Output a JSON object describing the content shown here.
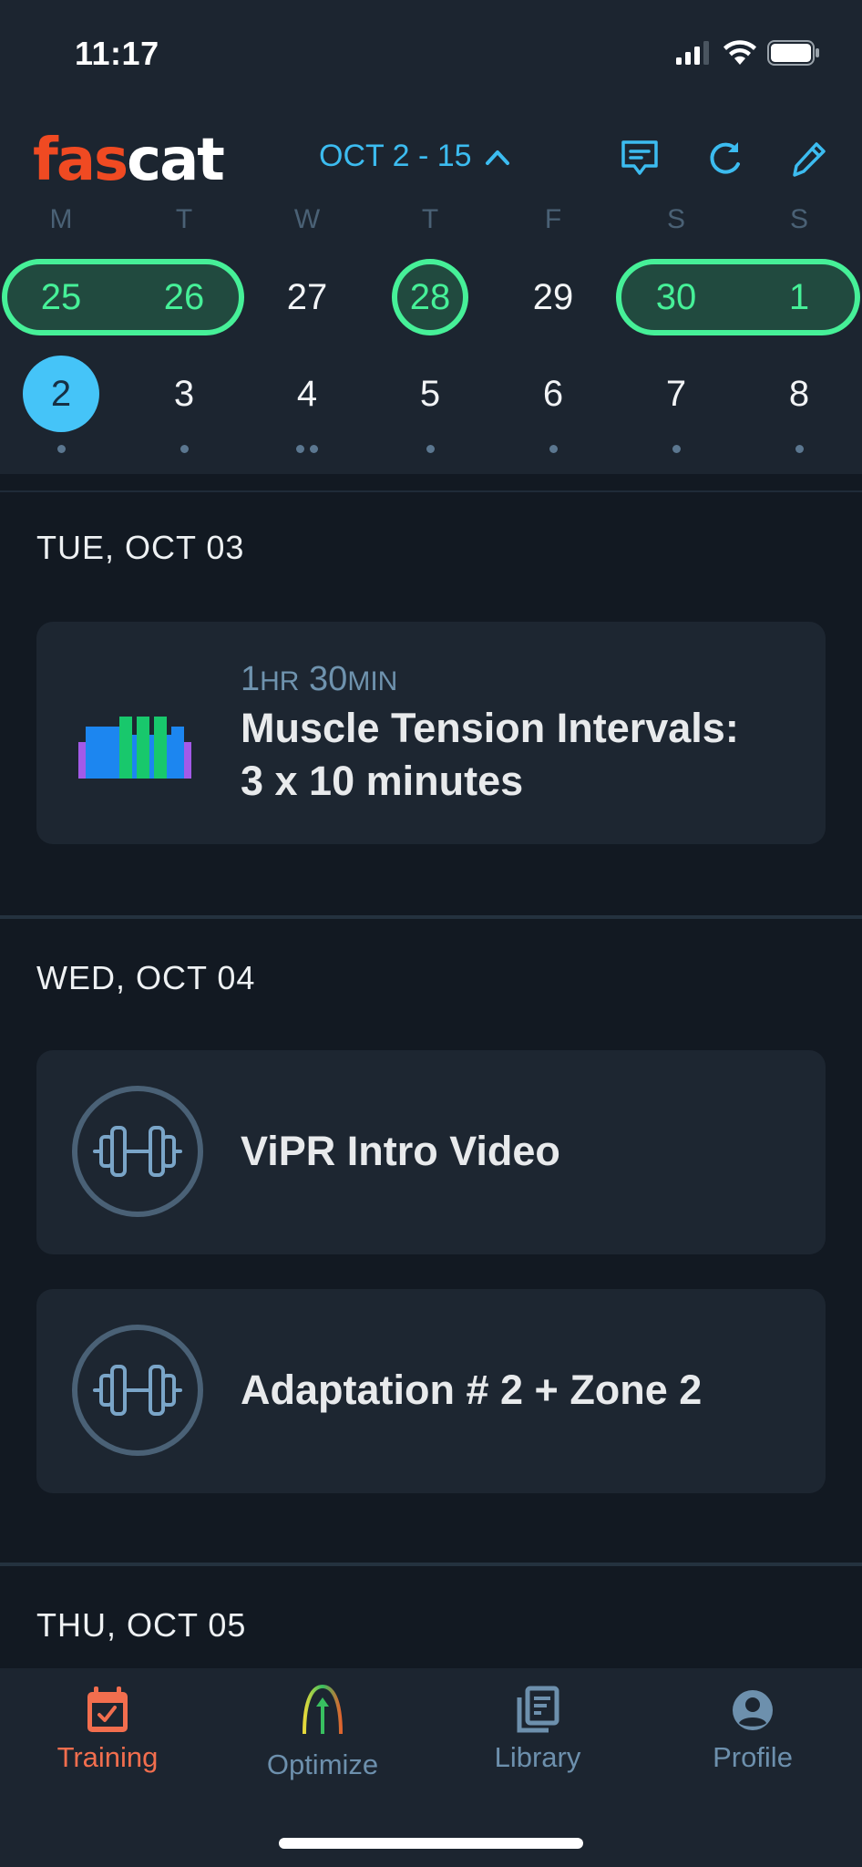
{
  "status_bar": {
    "time": "11:17",
    "icons": [
      "cellular-signal-icon",
      "wifi-icon",
      "battery-icon"
    ]
  },
  "header": {
    "logo_part1": "fas",
    "logo_part2": "cat",
    "date_range": "OCT 2 - 15",
    "actions": [
      {
        "name": "messages-icon"
      },
      {
        "name": "refresh-icon"
      },
      {
        "name": "edit-icon"
      }
    ]
  },
  "calendar": {
    "weekdays": [
      "M",
      "T",
      "W",
      "T",
      "F",
      "S",
      "S"
    ],
    "week1": [
      {
        "day": "25",
        "completed": true
      },
      {
        "day": "26",
        "completed": true
      },
      {
        "day": "27",
        "completed": false
      },
      {
        "day": "28",
        "completed": true
      },
      {
        "day": "29",
        "completed": false
      },
      {
        "day": "30",
        "completed": true
      },
      {
        "day": "1",
        "completed": true
      }
    ],
    "week2": [
      {
        "day": "2",
        "today": true,
        "workouts": 1
      },
      {
        "day": "3",
        "workouts": 1
      },
      {
        "day": "4",
        "workouts": 2
      },
      {
        "day": "5",
        "workouts": 1
      },
      {
        "day": "6",
        "workouts": 1
      },
      {
        "day": "7",
        "workouts": 1
      },
      {
        "day": "8",
        "workouts": 1
      }
    ]
  },
  "feed": [
    {
      "date": "TUE, OCT 03",
      "workouts": [
        {
          "type": "interval-chart-icon",
          "duration_hr": "1",
          "duration_hr_unit": "HR",
          "duration_min": "30",
          "duration_min_unit": "MIN",
          "title_line1": "Muscle Tension Intervals:",
          "title_line2": "3 x 10 minutes"
        }
      ]
    },
    {
      "date": "WED, OCT 04",
      "workouts": [
        {
          "type": "dumbbell-icon",
          "title": "ViPR Intro Video"
        },
        {
          "type": "dumbbell-icon",
          "title": "Adaptation # 2 + Zone 2"
        }
      ]
    },
    {
      "date": "THU, OCT 05",
      "workouts": []
    }
  ],
  "tabbar": {
    "tabs": [
      {
        "label": "Training",
        "active": true
      },
      {
        "label": "Optimize",
        "active": false
      },
      {
        "label": "Library",
        "active": false
      },
      {
        "label": "Profile",
        "active": false
      }
    ]
  },
  "colors": {
    "accent_blue": "#3cbcf0",
    "completed_green": "#46f098",
    "brand_orange": "#f04a22",
    "active_tab": "#f26e4e"
  }
}
